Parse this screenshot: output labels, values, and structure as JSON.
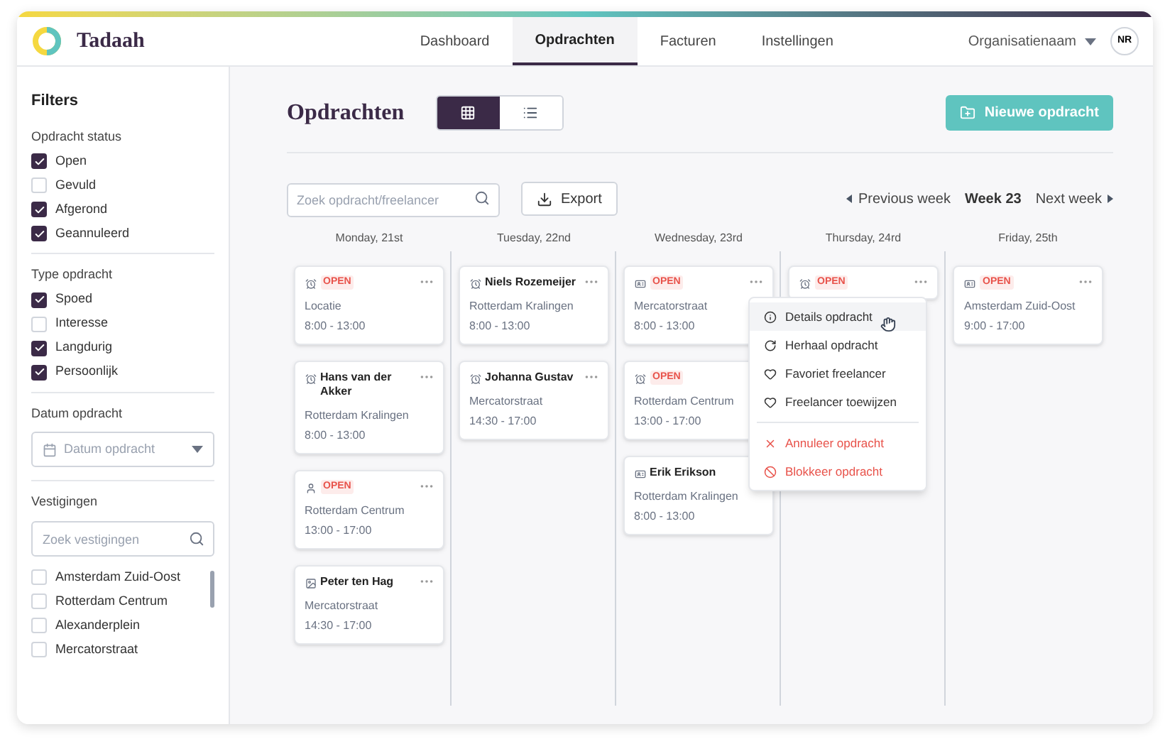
{
  "brand": "Tadaah",
  "nav": [
    {
      "label": "Dashboard",
      "selected": false
    },
    {
      "label": "Opdrachten",
      "selected": true
    },
    {
      "label": "Facturen",
      "selected": false
    },
    {
      "label": "Instellingen",
      "selected": false
    }
  ],
  "organisation": "Organisatienaam",
  "avatar": "NR",
  "sidebar": {
    "title": "Filters",
    "groups": [
      {
        "title": "Opdracht status",
        "options": [
          {
            "label": "Open",
            "checked": true
          },
          {
            "label": "Gevuld",
            "checked": false
          },
          {
            "label": "Afgerond",
            "checked": true
          },
          {
            "label": "Geannuleerd",
            "checked": true
          }
        ]
      },
      {
        "title": "Type opdracht",
        "options": [
          {
            "label": "Spoed",
            "checked": true
          },
          {
            "label": "Interesse",
            "checked": false
          },
          {
            "label": "Langdurig",
            "checked": true
          },
          {
            "label": "Persoonlijk",
            "checked": true
          }
        ]
      }
    ],
    "date": {
      "title": "Datum opdracht",
      "placeholder": "Datum opdracht"
    },
    "locations": {
      "title": "Vestigingen",
      "placeholder": "Zoek vestigingen",
      "options": [
        {
          "label": "Amsterdam Zuid-Oost",
          "checked": false
        },
        {
          "label": "Rotterdam Centrum",
          "checked": false
        },
        {
          "label": "Alexanderplein",
          "checked": false
        },
        {
          "label": "Mercatorstraat",
          "checked": false
        }
      ]
    }
  },
  "page_title": "Opdrachten",
  "view_toggle": [
    {
      "kind": "grid",
      "selected": true
    },
    {
      "kind": "list",
      "selected": false
    }
  ],
  "new_button": "Nieuwe opdracht",
  "search": {
    "placeholder": "Zoek opdracht/freelancer"
  },
  "export": "Export",
  "week_nav": {
    "previous": "Previous week",
    "current": "Week 23",
    "next": "Next week"
  },
  "days": [
    {
      "label": "Monday, 21st",
      "cards": [
        {
          "kind": "alarm",
          "badge": "OPEN",
          "location": "Locatie",
          "time": "8:00 - 13:00"
        },
        {
          "kind": "alarm",
          "name": "Hans van der Akker",
          "location": "Rotterdam Kralingen",
          "time": "8:00 - 13:00"
        },
        {
          "kind": "person",
          "badge": "OPEN",
          "location": "Rotterdam Centrum",
          "time": "13:00 - 17:00"
        },
        {
          "kind": "image",
          "name": "Peter ten Hag",
          "location": "Mercatorstraat",
          "time": "14:30 - 17:00"
        }
      ]
    },
    {
      "label": "Tuesday, 22nd",
      "cards": [
        {
          "kind": "alarm",
          "name": "Niels Rozemeijer",
          "location": "Rotterdam Kralingen",
          "time": "8:00 - 13:00"
        },
        {
          "kind": "alarm",
          "name": "Johanna Gustav",
          "location": "Mercatorstraat",
          "time": "14:30 - 17:00"
        }
      ]
    },
    {
      "label": "Wednesday, 23rd",
      "cards": [
        {
          "kind": "card",
          "badge": "OPEN",
          "location": "Mercatorstraat",
          "time": "8:00 - 13:00"
        },
        {
          "kind": "alarm",
          "badge": "OPEN",
          "location": "Rotterdam Centrum",
          "time": "13:00 - 17:00"
        },
        {
          "kind": "card",
          "name": "Erik Erikson",
          "location": "Rotterdam Kralingen",
          "time": "8:00 - 13:00"
        }
      ]
    },
    {
      "label": "Thursday, 24rd",
      "cards": [
        {
          "kind": "alarm",
          "badge": "OPEN"
        }
      ],
      "menu": [
        {
          "label": "Details opdracht",
          "kind": "info",
          "selected": true
        },
        {
          "label": "Herhaal opdracht",
          "kind": "repeat",
          "selected": false
        },
        {
          "label": "Favoriet freelancer",
          "kind": "heart",
          "selected": false
        },
        {
          "label": "Freelancer toewijzen",
          "kind": "heart",
          "selected": false
        },
        {
          "label": "Annuleer opdracht",
          "kind": "cancel",
          "selected": false
        },
        {
          "label": "Blokkeer opdracht",
          "kind": "block",
          "selected": false
        }
      ]
    },
    {
      "label": "Friday, 25th",
      "cards": [
        {
          "kind": "card",
          "badge": "OPEN",
          "location": "Amsterdam Zuid-Oost",
          "time": "9:00 - 17:00"
        }
      ]
    }
  ]
}
